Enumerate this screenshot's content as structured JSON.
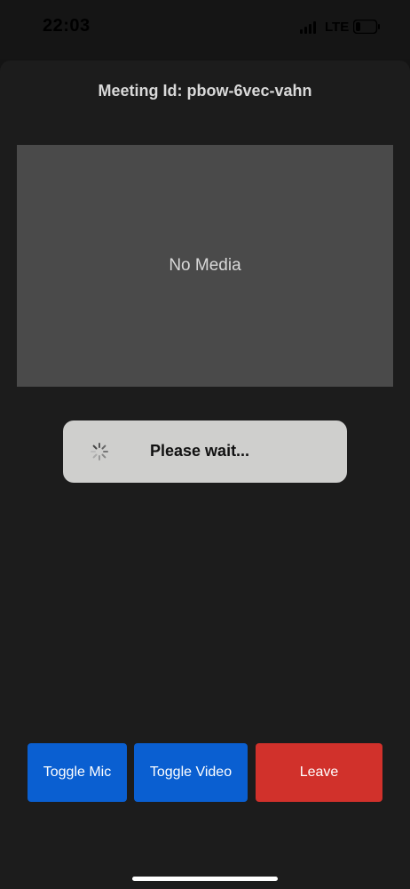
{
  "status_bar": {
    "time": "22:03",
    "network": "LTE",
    "icons": [
      "signal-icon",
      "battery-icon"
    ]
  },
  "meeting": {
    "id_label": "Meeting Id: pbow-6vec-vahn"
  },
  "media": {
    "placeholder": "No Media"
  },
  "loading": {
    "message": "Please wait...",
    "icon": "spinner-icon"
  },
  "controls": {
    "toggle_mic_label": "Toggle Mic",
    "toggle_video_label": "Toggle Video",
    "leave_label": "Leave"
  },
  "colors": {
    "primary_button": "#0a5fd1",
    "danger_button": "#d1312b",
    "background": "#1c1c1c",
    "media_panel": "#4a4a4a",
    "toast": "#cfcfcd"
  }
}
